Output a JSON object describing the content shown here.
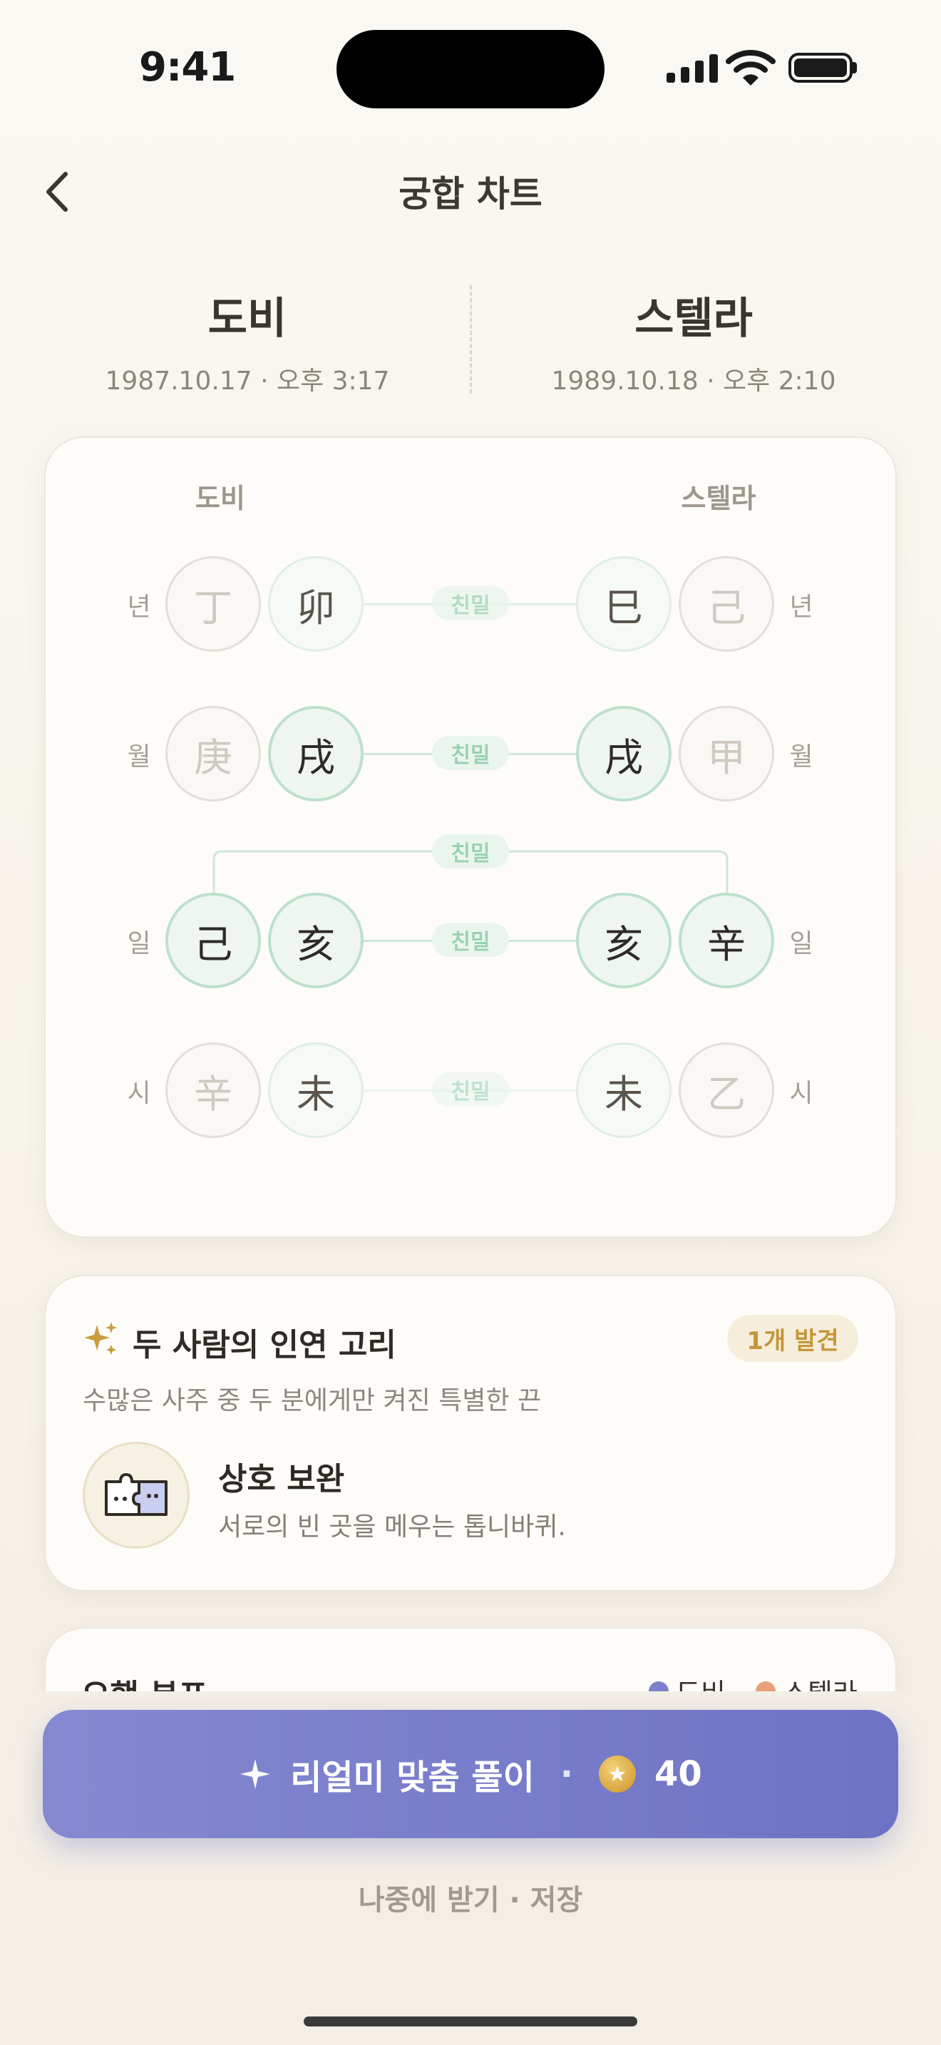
{
  "status": {
    "time": "9:41"
  },
  "header": {
    "title": "궁합 차트"
  },
  "persons": [
    {
      "name": "도비",
      "birth": "1987.10.17 · 오후 3:17"
    },
    {
      "name": "스텔라",
      "birth": "1989.10.18 · 오후 2:10"
    }
  ],
  "chart": {
    "left_label": "도비",
    "right_label": "스텔라",
    "rows": [
      {
        "label": "년",
        "left": [
          "丁",
          "卯"
        ],
        "right": [
          "巳",
          "己"
        ],
        "link": "친밀"
      },
      {
        "label": "월",
        "left": [
          "庚",
          "戌"
        ],
        "right": [
          "戌",
          "甲"
        ],
        "link": "친밀"
      },
      {
        "label": "일",
        "left": [
          "己",
          "亥"
        ],
        "right": [
          "亥",
          "辛"
        ],
        "link": "친밀"
      },
      {
        "label": "시",
        "left": [
          "辛",
          "未"
        ],
        "right": [
          "未",
          "乙"
        ],
        "link": "친밀"
      }
    ],
    "day_link": "친밀"
  },
  "connection": {
    "title": "두 사람의 인연 고리",
    "badge": "1개 발견",
    "subtitle": "수많은 사주 중 두 분에게만 켜진 특별한 끈",
    "item": {
      "title": "상호 보완",
      "desc": "서로의 빈 곳을 메우는 톱니바퀴.",
      "icon": "puzzle-icon"
    }
  },
  "elements_card": {
    "title": "오행 분포",
    "legend": [
      {
        "label": "도비",
        "color": "#7b80cc"
      },
      {
        "label": "스텔라",
        "color": "#e8a07a"
      }
    ]
  },
  "cta": {
    "label": "리얼미 맞춤 풀이",
    "separator": "·",
    "cost": "40"
  },
  "later": "나중에 받기 · 저장",
  "colors": {
    "accent": "#7479c8",
    "gold": "#c4963a",
    "mint": "#bde0cb"
  }
}
